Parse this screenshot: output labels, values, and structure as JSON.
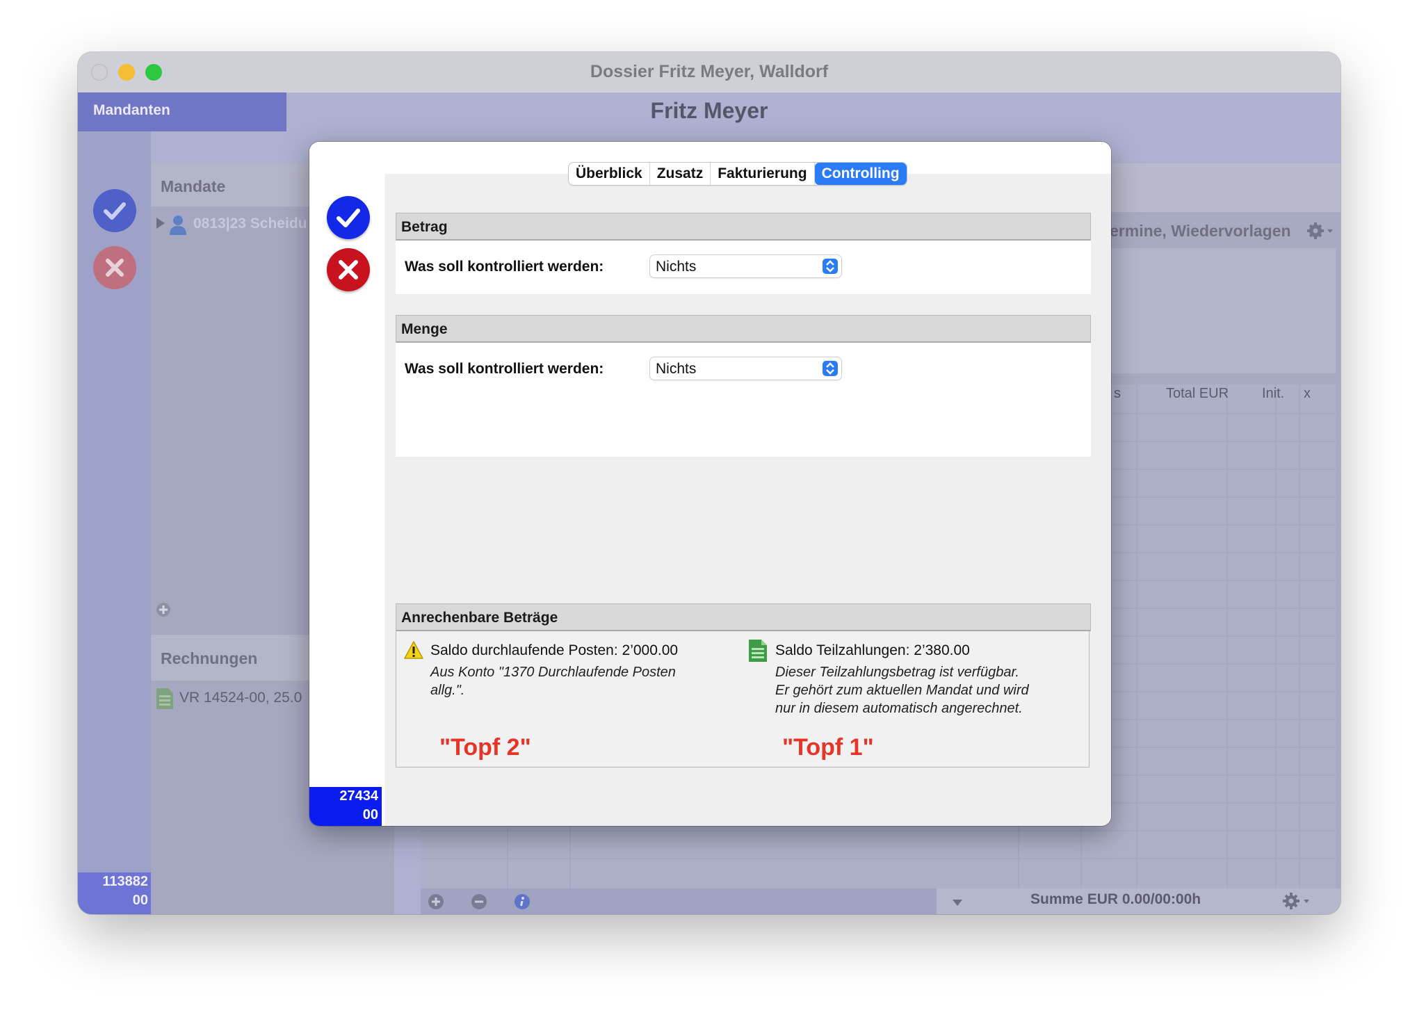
{
  "window": {
    "title": "Dossier Fritz Meyer, Walldorf",
    "traffic_lights": {
      "close": "#c9c9ce",
      "minimize": "#f5bd34",
      "zoom": "#2ec740"
    }
  },
  "background": {
    "mandanten_tab": "Mandanten",
    "client_name": "Fritz Meyer",
    "mandate_header": "Mandate",
    "mandate_row": "0813|23 Scheidu",
    "rechnungen_header": "Rechnungen",
    "rechnungen_row": "VR 14524-00, 25.0",
    "termine_header": "ermine, Wiedervorlagen",
    "table_columns": [
      "s",
      "Total EUR",
      "Init.",
      "x"
    ],
    "summe": "Summe EUR 0.00/00:00h",
    "left_id": [
      "113882",
      "00"
    ]
  },
  "dialog": {
    "tabs": [
      {
        "label": "Überblick",
        "active": false
      },
      {
        "label": "Zusatz",
        "active": false
      },
      {
        "label": "Fakturierung",
        "active": false
      },
      {
        "label": "Controlling",
        "active": true
      }
    ],
    "betrag": {
      "header": "Betrag",
      "label": "Was soll kontrolliert werden:",
      "value": "Nichts"
    },
    "menge": {
      "header": "Menge",
      "label": "Was soll kontrolliert werden:",
      "value": "Nichts"
    },
    "anrechenbare": {
      "header": "Anrechenbare Beträge",
      "left": {
        "icon": "warning-icon",
        "title": "Saldo durchlaufende Posten: 2’000.00",
        "desc_line1": "Aus Konto \"1370 Durchlaufende Posten",
        "desc_line2": "allg.\".",
        "annotation": "\"Topf 2\""
      },
      "right": {
        "icon": "document-icon",
        "title": "Saldo Teilzahlungen: 2’380.00",
        "desc_line1": "Dieser Teilzahlungsbetrag ist verfügbar.",
        "desc_line2": "Er gehört zum aktuellen Mandat und wird",
        "desc_line3": "nur in diesem automatisch angerechnet.",
        "annotation": "\"Topf 1\""
      }
    },
    "id": [
      "27434",
      "00"
    ]
  },
  "colors": {
    "accent_blue": "#2a7cf6",
    "confirm_blue": "#1428e8",
    "cancel_red": "#c8121e",
    "annotation_red": "#e63427",
    "id_badge_blue": "#0a1cf0"
  }
}
